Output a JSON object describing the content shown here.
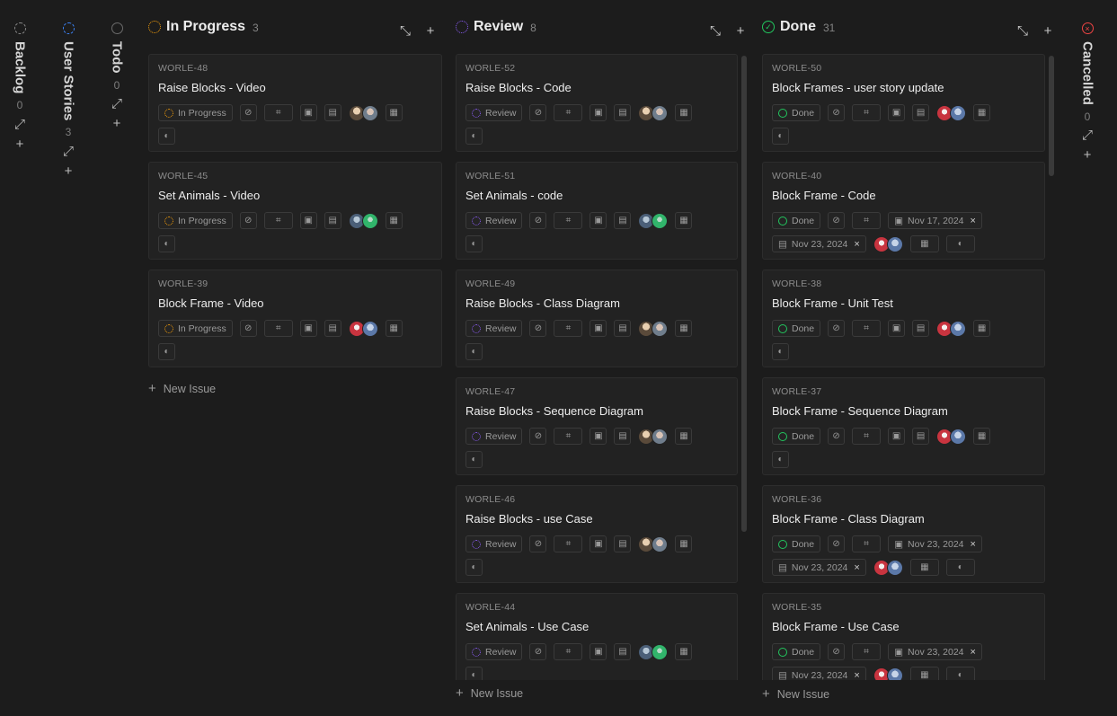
{
  "colors": {
    "in_progress": "#f59e0b",
    "review": "#8b5cf6",
    "done": "#22c55e",
    "cancelled": "#ef4444",
    "todo": "#6b6b6b",
    "user_stories": "#3b82f6"
  },
  "collapsed_left": [
    {
      "name": "Backlog",
      "count": "0"
    },
    {
      "name": "User Stories",
      "count": "3"
    },
    {
      "name": "Todo",
      "count": "0"
    }
  ],
  "collapsed_right": [
    {
      "name": "Cancelled",
      "count": "0"
    }
  ],
  "columns": [
    {
      "name": "In Progress",
      "count": "3",
      "status_label": "In Progress",
      "new_issue": "New Issue",
      "cards": [
        {
          "id": "WORLE-48",
          "title": "Raise Blocks - Video"
        },
        {
          "id": "WORLE-45",
          "title": "Set Animals - Video"
        },
        {
          "id": "WORLE-39",
          "title": "Block Frame - Video"
        }
      ]
    },
    {
      "name": "Review",
      "count": "8",
      "status_label": "Review",
      "new_issue": "New Issue",
      "cards": [
        {
          "id": "WORLE-52",
          "title": "Raise Blocks - Code"
        },
        {
          "id": "WORLE-51",
          "title": "Set Animals - code"
        },
        {
          "id": "WORLE-49",
          "title": "Raise Blocks - Class Diagram"
        },
        {
          "id": "WORLE-47",
          "title": "Raise Blocks - Sequence Diagram"
        },
        {
          "id": "WORLE-46",
          "title": "Raise Blocks - use Case"
        },
        {
          "id": "WORLE-44",
          "title": "Set Animals - Use Case"
        }
      ]
    },
    {
      "name": "Done",
      "count": "31",
      "status_label": "Done",
      "new_issue": "New Issue",
      "cards": [
        {
          "id": "WORLE-50",
          "title": "Block Frames - user story update"
        },
        {
          "id": "WORLE-40",
          "title": "Block Frame - Code",
          "start_date": "Nov 17, 2024",
          "due_date": "Nov 23, 2024"
        },
        {
          "id": "WORLE-38",
          "title": "Block Frame - Unit Test"
        },
        {
          "id": "WORLE-37",
          "title": "Block Frame - Sequence Diagram"
        },
        {
          "id": "WORLE-36",
          "title": "Block Frame - Class Diagram",
          "start_date": "Nov 23, 2024",
          "due_date": "Nov 23, 2024"
        },
        {
          "id": "WORLE-35",
          "title": "Block Frame - Use Case",
          "start_date": "Nov 23, 2024",
          "due_date": "Nov 23, 2024"
        }
      ]
    }
  ]
}
